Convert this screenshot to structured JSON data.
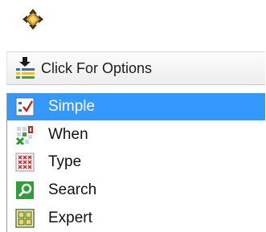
{
  "options_bar": {
    "label": "Click For Options",
    "icon": "options-list-icon"
  },
  "move_handle": {
    "icon": "move-arrows-icon"
  },
  "menu": {
    "selected_color": "#3399ff",
    "items": [
      {
        "label": "Simple",
        "icon": "simple-checklist-icon",
        "selected": true
      },
      {
        "label": "When",
        "icon": "when-grid-icon",
        "selected": false
      },
      {
        "label": "Type",
        "icon": "type-grid-icon",
        "selected": false
      },
      {
        "label": "Search",
        "icon": "search-icon",
        "selected": false
      },
      {
        "label": "Expert",
        "icon": "expert-grid-icon",
        "selected": false
      }
    ]
  }
}
